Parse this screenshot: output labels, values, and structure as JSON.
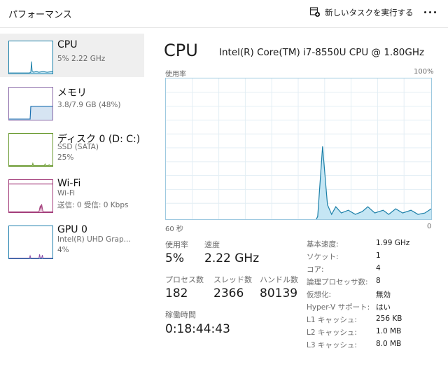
{
  "header": {
    "page_title": "パフォーマンス",
    "new_task_label": "新しいタスクを実行する"
  },
  "sidebar": {
    "items": [
      {
        "title": "CPU",
        "sub1": "5%  2.22 GHz",
        "sub2": ""
      },
      {
        "title": "メモリ",
        "sub1": "3.8/7.9 GB (48%)",
        "sub2": ""
      },
      {
        "title": "ディスク 0 (D: C:)",
        "sub1": "SSD (SATA)",
        "sub2": "25%"
      },
      {
        "title": "Wi-Fi",
        "sub1": "Wi-Fi",
        "sub2": "送信: 0 受信: 0 Kbps"
      },
      {
        "title": "GPU 0",
        "sub1": "Intel(R) UHD Grap...",
        "sub2": "4%"
      }
    ]
  },
  "main": {
    "title": "CPU",
    "model": "Intel(R) Core(TM) i7-8550U CPU @ 1.80GHz",
    "graph_label": "使用率",
    "graph_max": "100%",
    "graph_time_left": "60 秒",
    "graph_time_right": "0",
    "stats": {
      "usage_label": "使用率",
      "usage_value": "5%",
      "speed_label": "速度",
      "speed_value": "2.22 GHz",
      "processes_label": "プロセス数",
      "processes_value": "182",
      "threads_label": "スレッド数",
      "threads_value": "2366",
      "handles_label": "ハンドル数",
      "handles_value": "80139",
      "uptime_label": "稼働時間",
      "uptime_value": "0:18:44:43"
    },
    "specs": [
      {
        "label": "基本速度:",
        "value": "1.99 GHz"
      },
      {
        "label": "ソケット:",
        "value": "1"
      },
      {
        "label": "コア:",
        "value": "4"
      },
      {
        "label": "論理プロセッサ数:",
        "value": "8"
      },
      {
        "label": "仮想化:",
        "value": "無効"
      },
      {
        "label": "Hyper-V サポート:",
        "value": "はい"
      },
      {
        "label": "L1 キャッシュ:",
        "value": "256 KB"
      },
      {
        "label": "L2 キャッシュ:",
        "value": "1.0 MB"
      },
      {
        "label": "L3 キャッシュ:",
        "value": "8.0 MB"
      }
    ]
  },
  "colors": {
    "cpu_line": "#1a7fa8",
    "cpu_fill": "#c5e6f4",
    "grid": "#e3eef4"
  }
}
